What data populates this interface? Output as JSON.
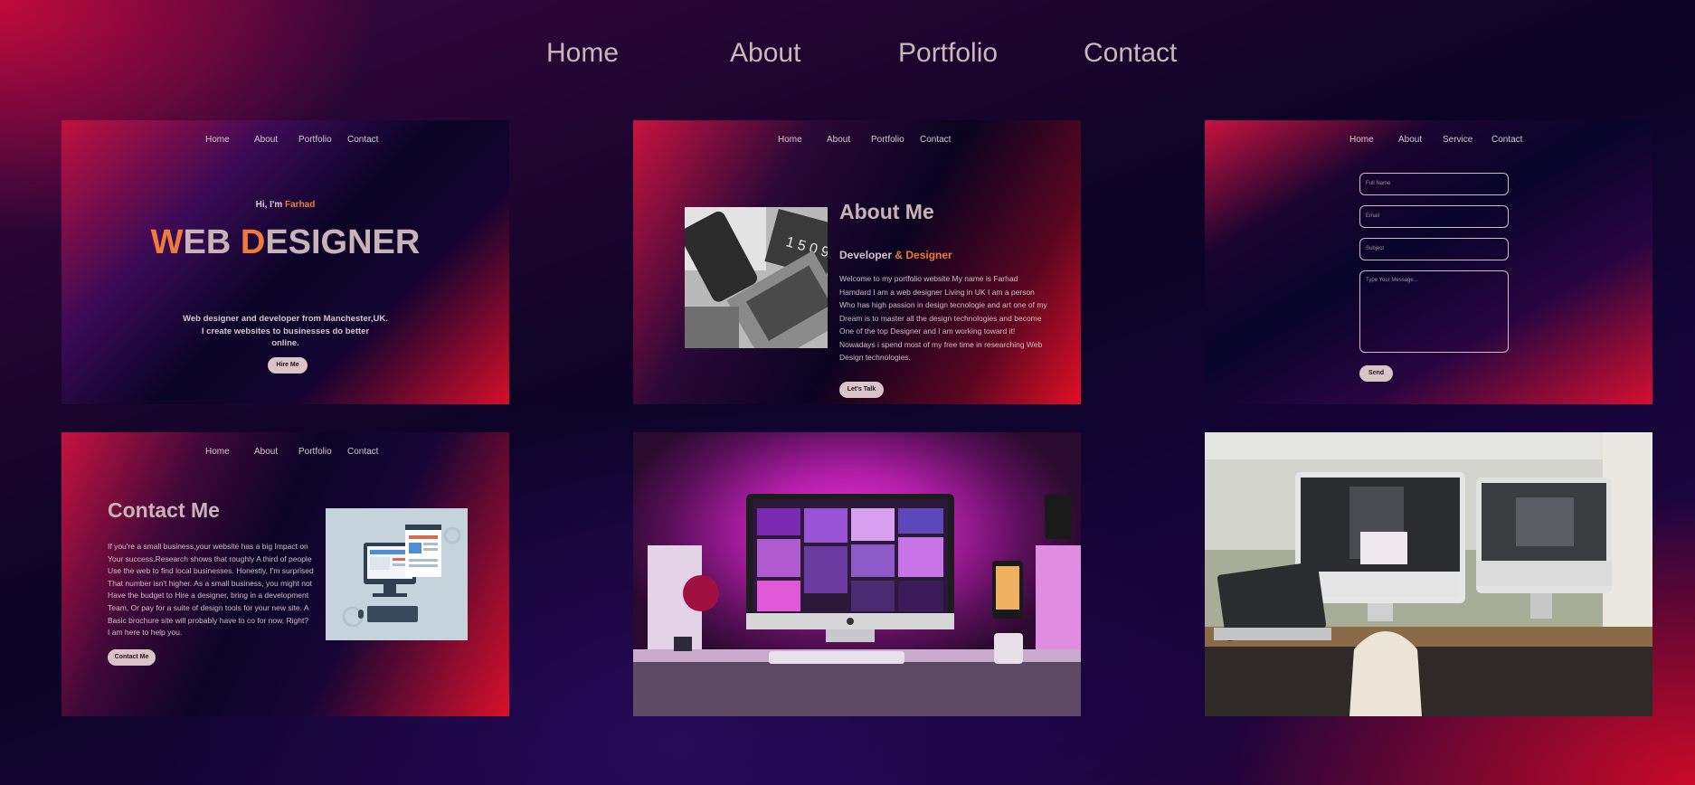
{
  "topnav": [
    "Home",
    "About",
    "Portfolio",
    "Contact"
  ],
  "card1": {
    "nav": [
      "Home",
      "About",
      "Portfolio",
      "Contact"
    ],
    "greeting": "Hi, I'm ",
    "name": "Farhad",
    "hero_w": "W",
    "hero_eb": "EB ",
    "hero_d": "D",
    "hero_esigner": "ESIGNER",
    "tagline": [
      "Web designer and developer from Manchester,UK.",
      "I create websites to businesses do better",
      "online."
    ],
    "button": "Hire Me"
  },
  "card2": {
    "nav": [
      "Home",
      "About",
      "Portfolio",
      "Contact"
    ],
    "title": "About Me",
    "subtitle_a": "Developer ",
    "subtitle_b": "& Designer",
    "body": [
      "Welcome to my portfolio website My name is Farhad",
      "Hamdard I am a web designer Living in UK I am a person",
      "Who has high passion in design tecnologie and art one of my",
      "Dream is to master all the design technologies and become",
      "One of the top Designer and I am working toward it!",
      "Nowadays i spend most of my free time in researching Web",
      "Design technologies."
    ],
    "button": "Let's Talk"
  },
  "card3": {
    "nav": [
      "Home",
      "About",
      "Service",
      "Contact"
    ],
    "fields": [
      "Full Name",
      "Email",
      "Subject"
    ],
    "message_placeholder": "Type Your Message...",
    "button": "Send"
  },
  "card4": {
    "nav": [
      "Home",
      "About",
      "Portfolio",
      "Contact"
    ],
    "title": "Contact Me",
    "body": [
      "If you're a small business,your website has a big Impact on",
      "Your success.Research shows that roughly A third of people",
      "Use the web to find local businesses. Honestly, I'm surprised",
      "That number isn't higher. As a small business, you might not",
      "Have the budget to Hire a designer, bring in a development",
      "Team, Or pay for a suite of design tools for your new site. A",
      "Basic brochure site will probably have to co for now, Right?",
      "I am here to help you."
    ],
    "button": "Contact Me"
  },
  "colors": {
    "accent_orange": "#ee7b3b",
    "nav_text": "#c9b6b8",
    "pill": "#d9c4c8"
  }
}
